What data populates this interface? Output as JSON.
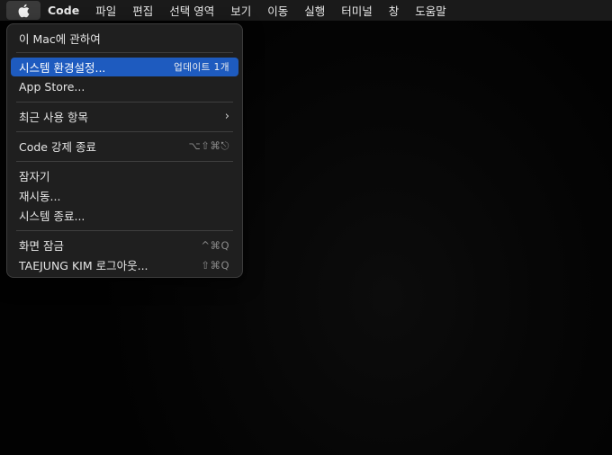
{
  "menubar": {
    "apple_icon": "apple-logo-icon",
    "app_name": "Code",
    "items": [
      "파일",
      "편집",
      "선택 영역",
      "보기",
      "이동",
      "실행",
      "터미널",
      "창",
      "도움말"
    ]
  },
  "apple_menu": {
    "about": "이 Mac에 관하여",
    "system_settings": "시스템 환경설정...",
    "system_settings_badge": "업데이트 1개",
    "app_store": "App Store...",
    "recent_items": "최근 사용 항목",
    "force_quit": "Code 강제 종료",
    "force_quit_shortcut": "⌥⇧⌘⎋",
    "sleep": "잠자기",
    "restart": "재시동...",
    "shutdown": "시스템 종료...",
    "lock_screen": "화면 잠금",
    "lock_screen_shortcut": "^⌘Q",
    "logout": "TAEJUNG KIM 로그아웃...",
    "logout_shortcut": "⇧⌘Q"
  },
  "colors": {
    "selection": "#1e5bbf",
    "menu_bg": "#1f1f1f",
    "menubar_bg": "#1a1a1a"
  }
}
